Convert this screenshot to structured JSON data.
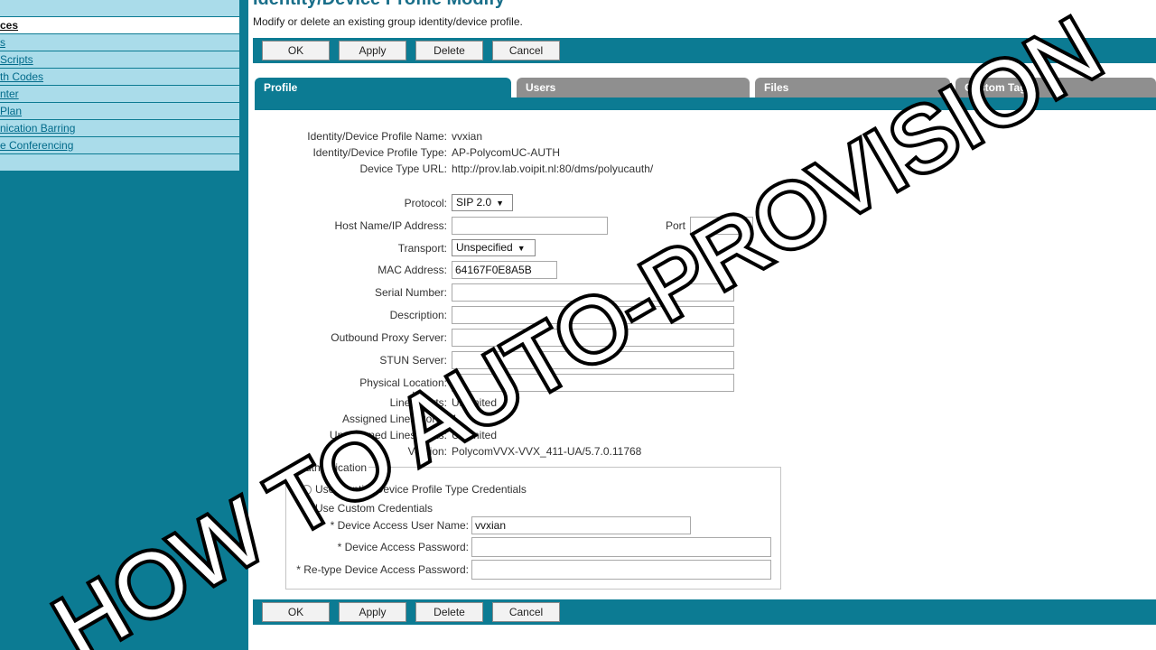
{
  "sidebar": {
    "items": [
      {
        "label": ""
      },
      {
        "label": "ces"
      },
      {
        "label": "s"
      },
      {
        "label": "Scripts"
      },
      {
        "label": "th Codes"
      },
      {
        "label": "nter"
      },
      {
        "label": "Plan"
      },
      {
        "label": "nication Barring"
      },
      {
        "label": "e Conferencing"
      },
      {
        "label": ""
      }
    ]
  },
  "page": {
    "title": "Identity/Device Profile Modify",
    "subtitle": "Modify or delete an existing group identity/device profile."
  },
  "buttons": {
    "ok": "OK",
    "apply": "Apply",
    "delete": "Delete",
    "cancel": "Cancel"
  },
  "tabs": {
    "profile": "Profile",
    "users": "Users",
    "files": "Files",
    "custom_tags": "Custom Tags"
  },
  "profile": {
    "name_label": "Identity/Device Profile Name:",
    "name": "vvxian",
    "type_label": "Identity/Device Profile Type:",
    "type": "AP-PolycomUC-AUTH",
    "url_label": "Device Type URL:",
    "url": "http://prov.lab.voipit.nl:80/dms/polyucauth/",
    "protocol_label": "Protocol:",
    "protocol": "SIP 2.0",
    "host_label": "Host Name/IP Address:",
    "host": "",
    "port_label": "Port",
    "port": "",
    "transport_label": "Transport:",
    "transport": "Unspecified",
    "mac_label": "MAC Address:",
    "mac": "64167F0E8A5B",
    "serial_label": "Serial Number:",
    "serial": "",
    "description_label": "Description:",
    "description": "",
    "proxy_label": "Outbound Proxy Server:",
    "proxy": "",
    "stun_label": "STUN Server:",
    "stun": "",
    "location_label": "Physical Location:",
    "location": "",
    "lines_label": "Lines/Ports:",
    "lines": "Unlimited",
    "assigned_label": "Assigned Lines/Ports:",
    "assigned": "1",
    "unassigned_label": "Unassigned Lines/Ports:",
    "unassigned": "Unlimited",
    "version_label": "Version:",
    "version": "PolycomVVX-VVX_411-UA/5.7.0.11768"
  },
  "auth": {
    "legend": "Authentication",
    "option_type": "Use Identity/Device Profile Type Credentials",
    "option_custom": "Use Custom Credentials",
    "user_label": "* Device Access User Name:",
    "user": "vvxian",
    "pass_label": "* Device Access Password:",
    "pass": "",
    "retype_label": "* Re-type Device Access Password:",
    "retype": ""
  },
  "overlay": {
    "text": "HOW TO AUTO-PROVISION"
  },
  "colors": {
    "accent": "#0c7b93",
    "sidebar_item": "#aadcea",
    "tab_inactive": "#8f8f8f"
  }
}
